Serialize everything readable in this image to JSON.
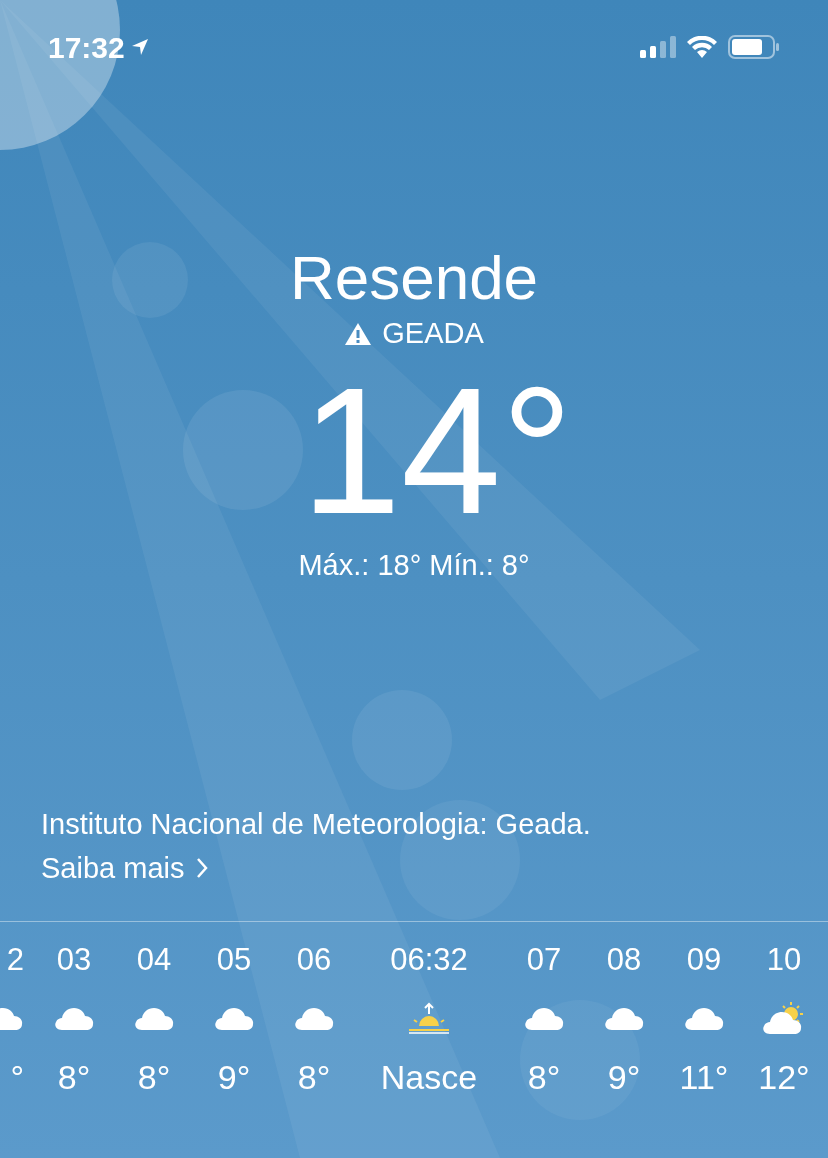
{
  "status_bar": {
    "time": "17:32"
  },
  "location": {
    "city": "Resende",
    "alert": "GEADA",
    "temperature": "14°",
    "high_low": "Máx.: 18° Mín.: 8°"
  },
  "notice": {
    "text": "Instituto Nacional de Meteorologia: Geada.",
    "link": "Saiba mais"
  },
  "hourly": [
    {
      "hour": "2",
      "kind": "cloud",
      "temp": "°"
    },
    {
      "hour": "03",
      "kind": "cloud",
      "temp": "8°"
    },
    {
      "hour": "04",
      "kind": "cloud",
      "temp": "8°"
    },
    {
      "hour": "05",
      "kind": "cloud",
      "temp": "9°"
    },
    {
      "hour": "06",
      "kind": "cloud",
      "temp": "8°"
    },
    {
      "hour": "06:32",
      "kind": "sunrise",
      "temp": "Nasce"
    },
    {
      "hour": "07",
      "kind": "cloud",
      "temp": "8°"
    },
    {
      "hour": "08",
      "kind": "cloud",
      "temp": "9°"
    },
    {
      "hour": "09",
      "kind": "cloud",
      "temp": "11°"
    },
    {
      "hour": "10",
      "kind": "partly_sunny",
      "temp": "12°"
    }
  ]
}
